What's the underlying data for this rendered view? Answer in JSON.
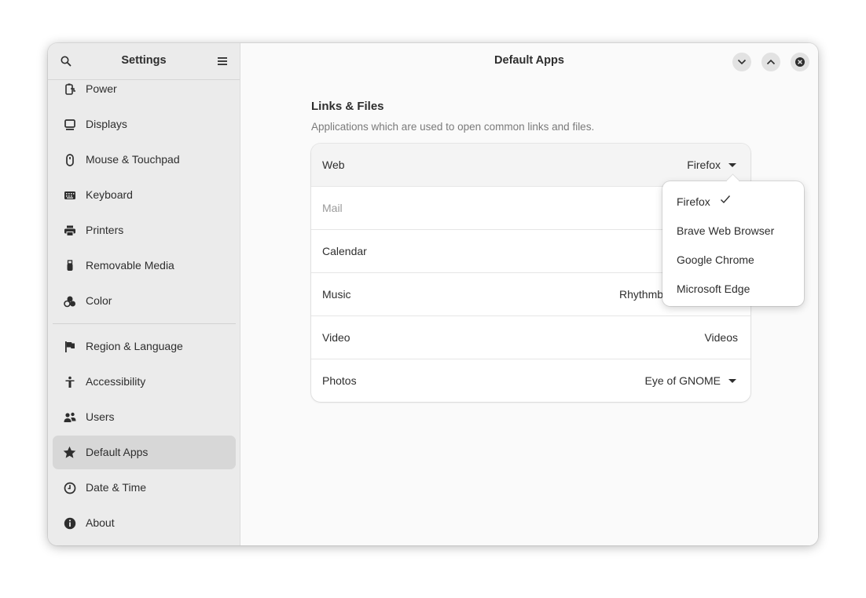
{
  "sidebar": {
    "title": "Settings",
    "search_icon": "search-icon",
    "menu_icon": "hamburger-menu-icon",
    "items": [
      {
        "label": "Power",
        "icon": "power-icon"
      },
      {
        "label": "Displays",
        "icon": "display-icon"
      },
      {
        "label": "Mouse & Touchpad",
        "icon": "mouse-icon"
      },
      {
        "label": "Keyboard",
        "icon": "keyboard-icon"
      },
      {
        "label": "Printers",
        "icon": "printer-icon"
      },
      {
        "label": "Removable Media",
        "icon": "usb-icon"
      },
      {
        "label": "Color",
        "icon": "color-icon"
      },
      {
        "label": "Region & Language",
        "icon": "flag-icon"
      },
      {
        "label": "Accessibility",
        "icon": "accessibility-icon"
      },
      {
        "label": "Users",
        "icon": "users-icon"
      },
      {
        "label": "Default Apps",
        "icon": "star-icon",
        "active": true
      },
      {
        "label": "Date & Time",
        "icon": "clock-icon"
      },
      {
        "label": "About",
        "icon": "info-icon"
      }
    ]
  },
  "main": {
    "title": "Default Apps",
    "window_controls": [
      "minimize",
      "maximize",
      "close"
    ],
    "section": {
      "title": "Links & Files",
      "subtitle": "Applications which are used to open common links and files."
    },
    "rows": [
      {
        "label": "Web",
        "value": "Firefox"
      },
      {
        "label": "Mail",
        "value": ""
      },
      {
        "label": "Calendar",
        "value": ""
      },
      {
        "label": "Music",
        "value": "Rhythmb"
      },
      {
        "label": "Video",
        "value": "Videos"
      },
      {
        "label": "Photos",
        "value": "Eye of GNOME"
      }
    ]
  },
  "popover": {
    "items": [
      {
        "label": "Firefox",
        "selected": true
      },
      {
        "label": "Brave Web Browser"
      },
      {
        "label": "Google Chrome"
      },
      {
        "label": "Microsoft Edge"
      }
    ]
  },
  "colors": {
    "sidebar_bg": "#ebebeb",
    "active_item_bg": "#d7d7d7",
    "content_bg": "#fafafa",
    "text": "#2e2e2e",
    "dim_text": "#7a7a7a"
  }
}
